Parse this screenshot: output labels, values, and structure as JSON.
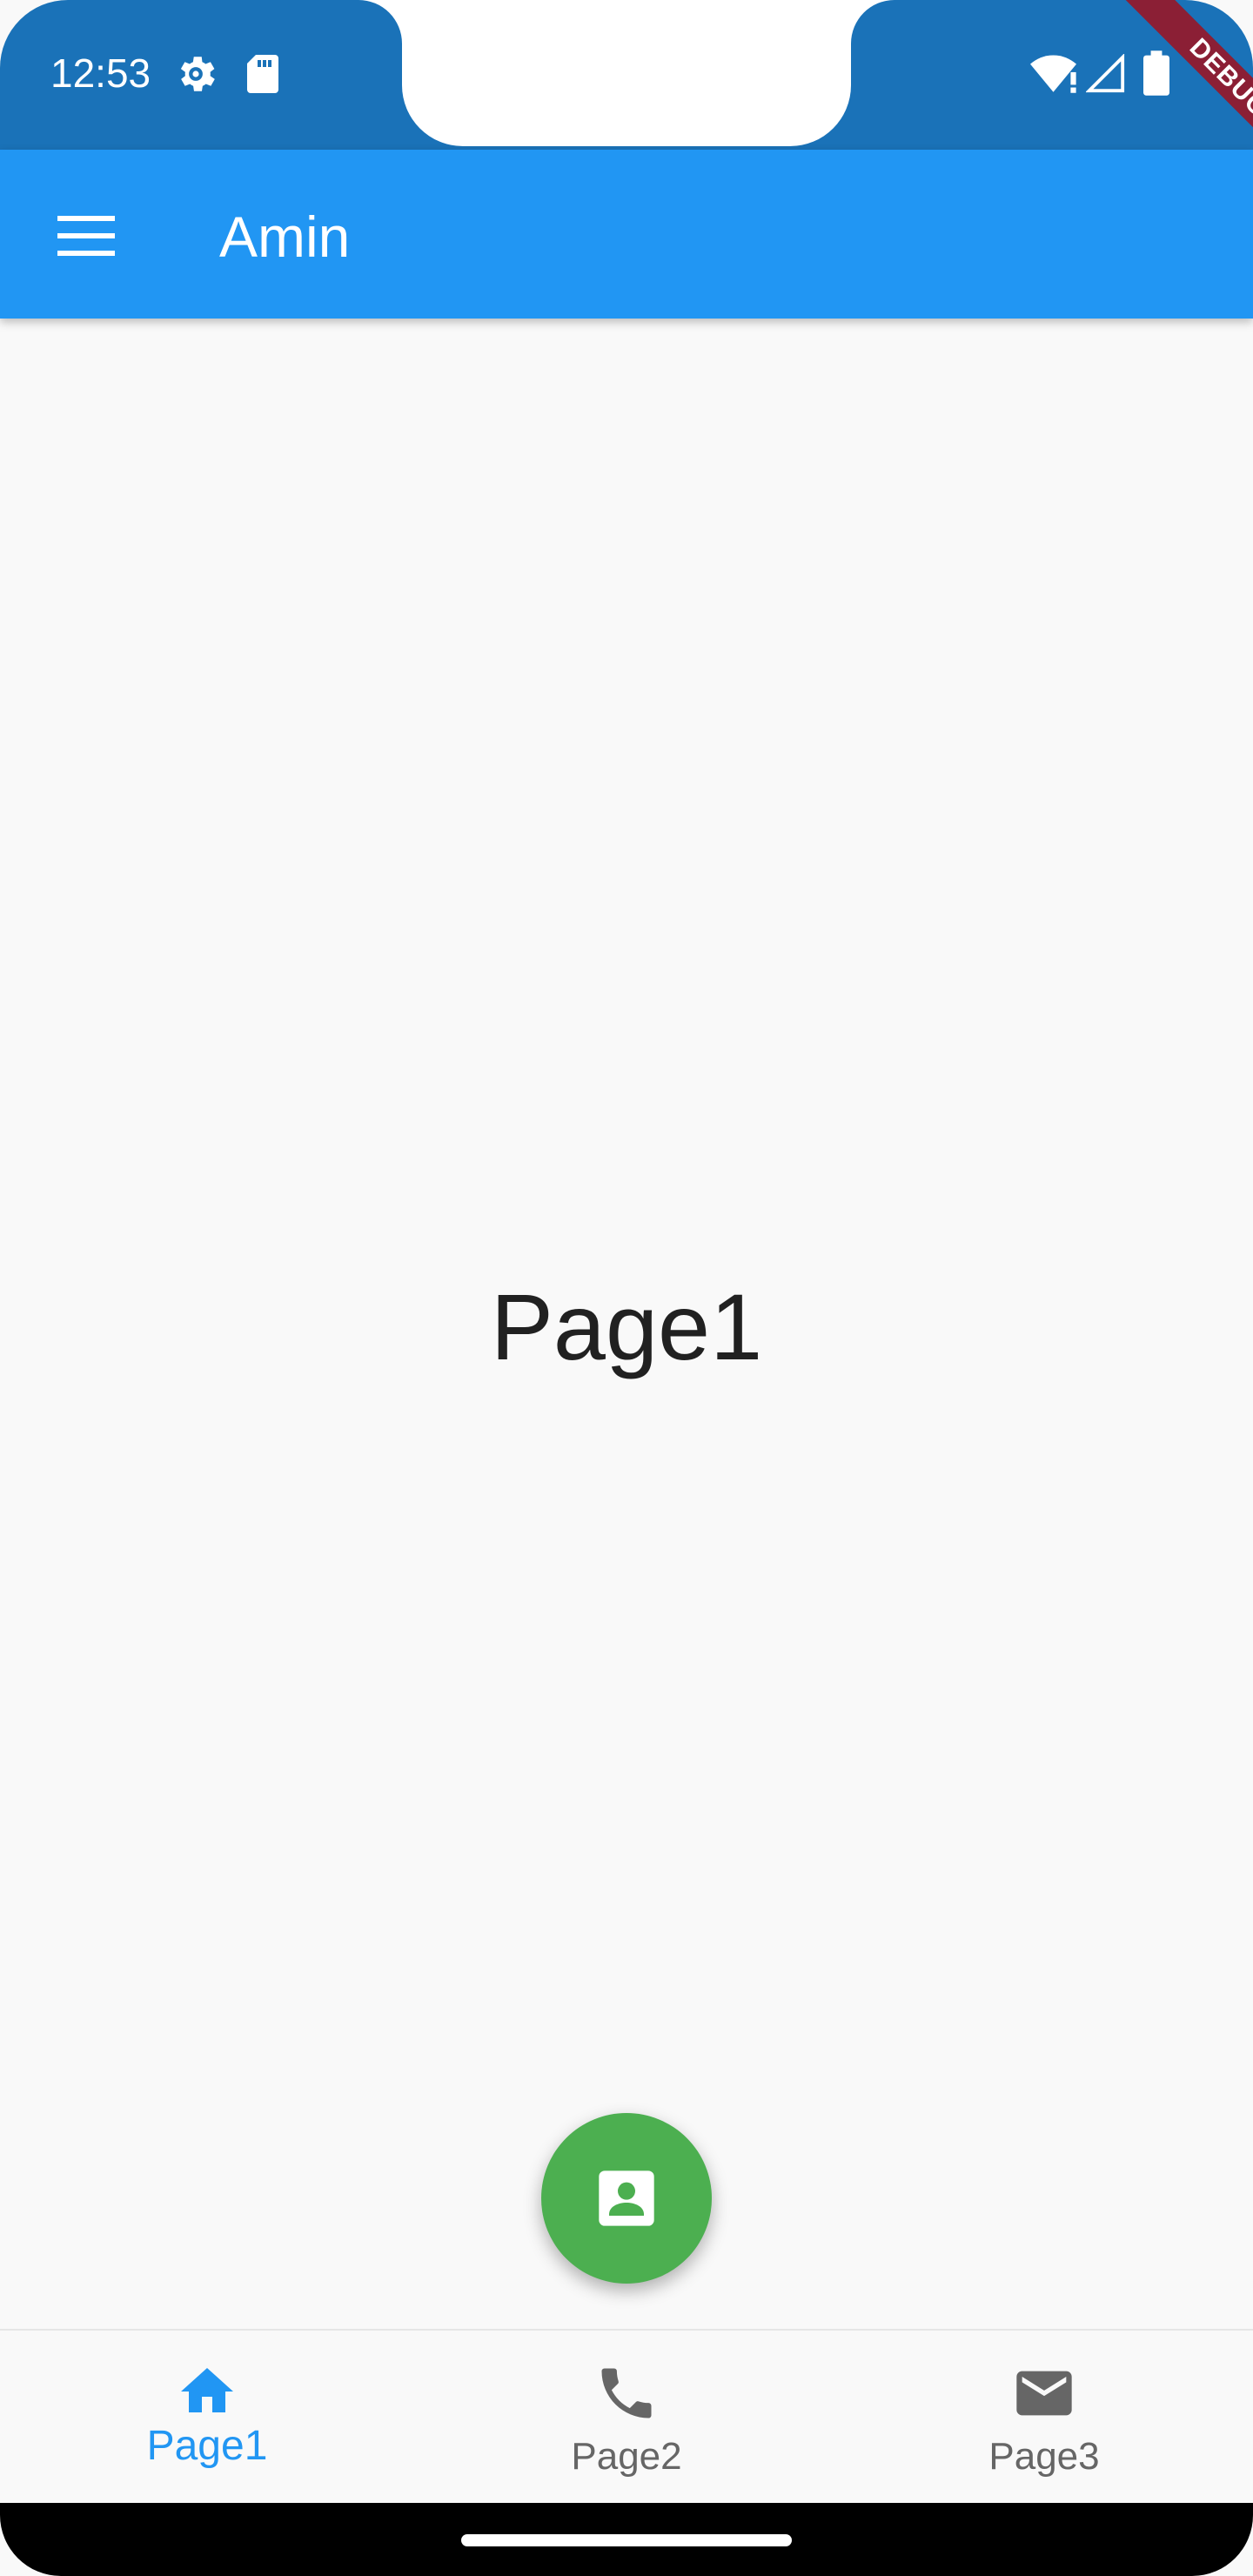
{
  "status_bar": {
    "time": "12:53",
    "icons": [
      "settings-gear-icon",
      "sd-card-icon",
      "wifi-alert-icon",
      "cell-signal-icon",
      "battery-icon"
    ]
  },
  "debug_banner": "DEBUG",
  "app_bar": {
    "title": "Amin",
    "menu_icon": "menu-icon"
  },
  "body": {
    "page_label": "Page1"
  },
  "fab": {
    "icon": "contact-card-icon"
  },
  "bottom_nav": {
    "items": [
      {
        "label": "Page1",
        "icon": "home-icon",
        "active": true
      },
      {
        "label": "Page2",
        "icon": "phone-icon",
        "active": false
      },
      {
        "label": "Page3",
        "icon": "mail-icon",
        "active": false
      }
    ]
  },
  "colors": {
    "status_bar": "#1a72b8",
    "app_bar": "#2196f3",
    "fab": "#4caf50",
    "active_nav": "#2196f3",
    "inactive_nav": "#666666",
    "debug_banner": "#8b1f35"
  }
}
